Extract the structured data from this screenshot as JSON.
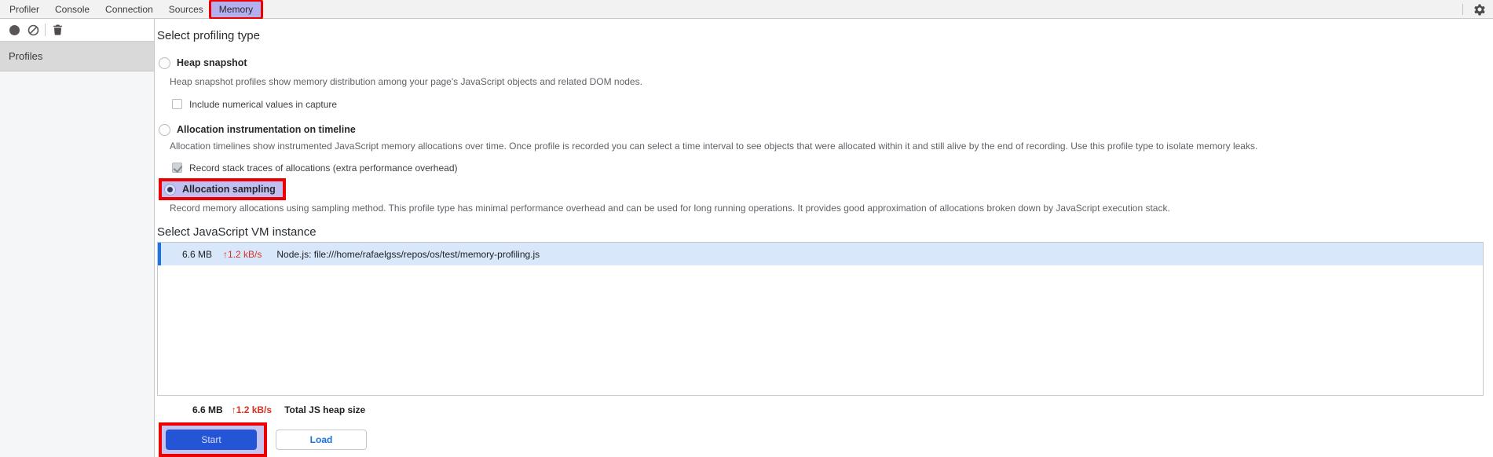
{
  "tabbar": {
    "tabs": [
      {
        "label": "Profiler",
        "selected": false
      },
      {
        "label": "Console",
        "selected": false
      },
      {
        "label": "Connection",
        "selected": false
      },
      {
        "label": "Sources",
        "selected": false
      },
      {
        "label": "Memory",
        "selected": true
      }
    ]
  },
  "toolbar": {
    "icons": [
      {
        "name": "record-icon",
        "shape": "filled-circle"
      },
      {
        "name": "block-icon",
        "shape": "circle-with-slash"
      },
      {
        "name": "trash-icon",
        "shape": "trash-can"
      }
    ]
  },
  "settings_icon": {
    "name": "gear-icon",
    "glyph": "gear"
  },
  "sidebar": {
    "profiles_label": "Profiles"
  },
  "profiling": {
    "heading": "Select profiling type",
    "options": [
      {
        "label": "Heap snapshot",
        "selected": false,
        "description": "Heap snapshot profiles show memory distribution among your page's JavaScript objects and related DOM nodes.",
        "checkbox": {
          "label": "Include numerical values in capture",
          "checked": false,
          "disabled": false
        }
      },
      {
        "label": "Allocation instrumentation on timeline",
        "selected": false,
        "description": "Allocation timelines show instrumented JavaScript memory allocations over time. Once profile is recorded you can select a time interval to see objects that were allocated within it and still alive by the end of recording. Use this profile type to isolate memory leaks.",
        "checkbox": {
          "label": "Record stack traces of allocations (extra performance overhead)",
          "checked": true,
          "disabled": true
        }
      },
      {
        "label": "Allocation sampling",
        "selected": true,
        "highlighted": true,
        "description": "Record memory allocations using sampling method. This profile type has minimal performance overhead and can be used for long running operations. It provides good approximation of allocations broken down by JavaScript execution stack."
      }
    ]
  },
  "vm": {
    "heading": "Select JavaScript VM instance",
    "instances": [
      {
        "size": "6.6 MB",
        "rate": "↑1.2 kB/s",
        "name": "Node.js: file:///home/rafaelgss/repos/os/test/memory-profiling.js",
        "selected": true
      }
    ]
  },
  "totals": {
    "size": "6.6 MB",
    "rate": "↑1.2 kB/s",
    "label": "Total JS heap size"
  },
  "actions": {
    "start": "Start",
    "load": "Load"
  },
  "colors": {
    "annotation_red": "#ec0000",
    "highlight_lavender": "#b4b0ee",
    "start_button_blue": "#2355d6",
    "selected_row_background": "#d8e8fa",
    "selected_row_accent": "#1a73e8",
    "stat_red": "#d93025"
  }
}
